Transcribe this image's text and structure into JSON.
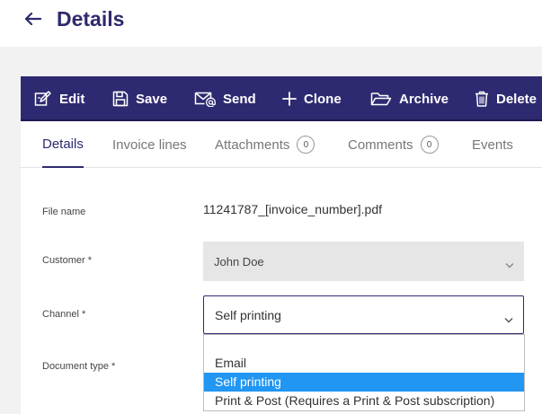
{
  "header": {
    "title": "Details"
  },
  "toolbar": {
    "edit": "Edit",
    "save": "Save",
    "send": "Send",
    "clone": "Clone",
    "archive": "Archive",
    "delete": "Delete"
  },
  "tabs": {
    "details": "Details",
    "invoice_lines": "Invoice lines",
    "attachments": "Attachments",
    "attachments_count": "0",
    "comments": "Comments",
    "comments_count": "0",
    "events": "Events"
  },
  "form": {
    "file_name_label": "File name",
    "file_name_value": "11241787_[invoice_number].pdf",
    "customer_label": "Customer *",
    "customer_value": "John Doe",
    "channel_label": "Channel *",
    "channel_value": "Self printing",
    "document_type_label": "Document type *"
  },
  "channel_options": [
    "Email",
    "Self printing",
    "Print & Post (Requires a Print & Post subscription)"
  ],
  "colors": {
    "accent": "#2e2a71",
    "title": "#2d2a6e",
    "selected_option": "#2196f3"
  }
}
